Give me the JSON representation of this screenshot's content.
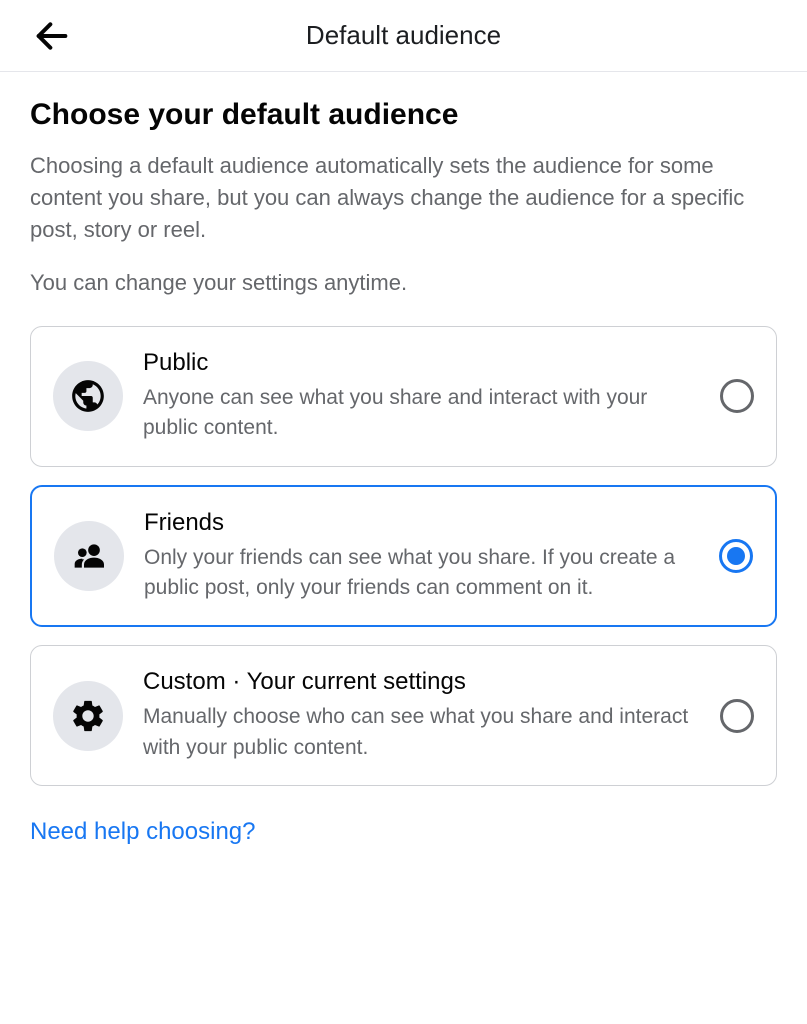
{
  "header": {
    "title": "Default audience"
  },
  "page": {
    "heading": "Choose your default audience",
    "description": "Choosing a default audience automatically sets the audience for some content you share, but you can always change the audience for a specific post, story or reel.",
    "sub_description": "You can change your settings anytime."
  },
  "options": {
    "public": {
      "title": "Public",
      "subtitle": "Anyone can see what you share and interact with your public content.",
      "selected": false
    },
    "friends": {
      "title": "Friends",
      "subtitle": "Only your friends can see what you share. If you create a public post, only your friends can comment on it.",
      "selected": true
    },
    "custom": {
      "title": "Custom · Your current settings",
      "subtitle": "Manually choose who can see what you share and interact with your public content.",
      "selected": false
    }
  },
  "help_link": "Need help choosing?"
}
